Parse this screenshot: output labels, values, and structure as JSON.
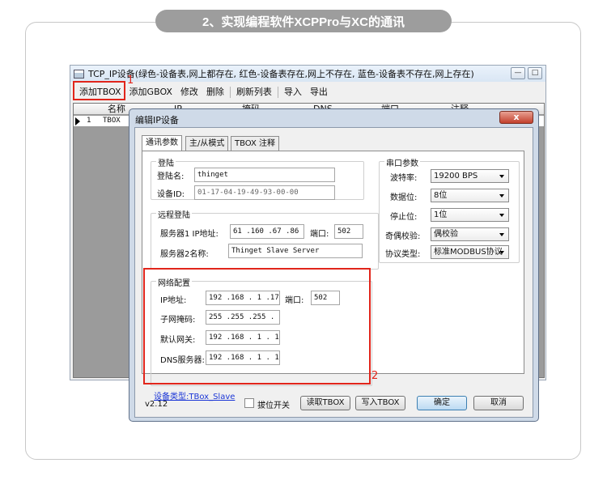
{
  "banner": "2、实现编程软件XCPPro与XC的通讯",
  "app": {
    "title": "TCP_IP设备(绿色-设备表,网上都存在, 红色-设备表存在,网上不存在, 蓝色-设备表不存在,网上存在)",
    "menu": [
      "添加TBOX",
      "添加GBOX",
      "修改",
      "删除",
      "刷新列表",
      "导入",
      "导出"
    ],
    "columns": [
      "名称",
      "IP",
      "掩码",
      "DNS",
      "端口",
      "注释"
    ],
    "row": {
      "num": "1",
      "type": "TBOX"
    }
  },
  "annotations": {
    "label1": "1",
    "label2": "2"
  },
  "dialog": {
    "title": "编辑IP设备",
    "close": "x",
    "tabs": [
      "通讯参数",
      "主/从模式",
      "TBOX 注释"
    ],
    "login": {
      "title": "登陆",
      "name_label": "登陆名:",
      "name_value": "thinget",
      "id_label": "设备ID:",
      "id_value": "01-17-04-19-49-93-00-00"
    },
    "remote": {
      "title": "远程登陆",
      "server1_label": "服务器1 IP地址:",
      "server1_ip": [
        "61",
        "160",
        "67",
        "86"
      ],
      "port_label": "端口:",
      "port_value": "502",
      "server2_label": "服务器2名称:",
      "server2_value": "Thinget Slave Server"
    },
    "network": {
      "title": "网络配置",
      "ip_label": "IP地址:",
      "ip_value": [
        "192",
        "168",
        "1",
        "178"
      ],
      "port_label": "端口:",
      "port_value": "502",
      "mask_label": "子网掩码:",
      "mask_value": [
        "255",
        "255",
        "255",
        "0"
      ],
      "gw_label": "默认网关:",
      "gw_value": [
        "192",
        "168",
        "1",
        "1"
      ],
      "dns_label": "DNS服务器:",
      "dns_value": [
        "192",
        "168",
        "1",
        "1"
      ]
    },
    "serial": {
      "title": "串口参数",
      "baud_label": "波特率:",
      "baud_value": "19200 BPS",
      "data_label": "数据位:",
      "data_value": "8位",
      "stop_label": "停止位:",
      "stop_value": "1位",
      "parity_label": "奇偶校验:",
      "parity_value": "偶校验",
      "proto_label": "协议类型:",
      "proto_value": "标准MODBUS协议"
    },
    "device_type": "设备类型:TBox_Slave",
    "version": "v2.12",
    "dip_label": "拔位开关",
    "buttons": {
      "read": "读取TBOX",
      "write": "写入TBOX",
      "ok": "确定",
      "cancel": "取消"
    }
  },
  "colors": {
    "annotation": "#e1251b",
    "banner": "#9d9d9d",
    "link": "#1b36d6"
  }
}
